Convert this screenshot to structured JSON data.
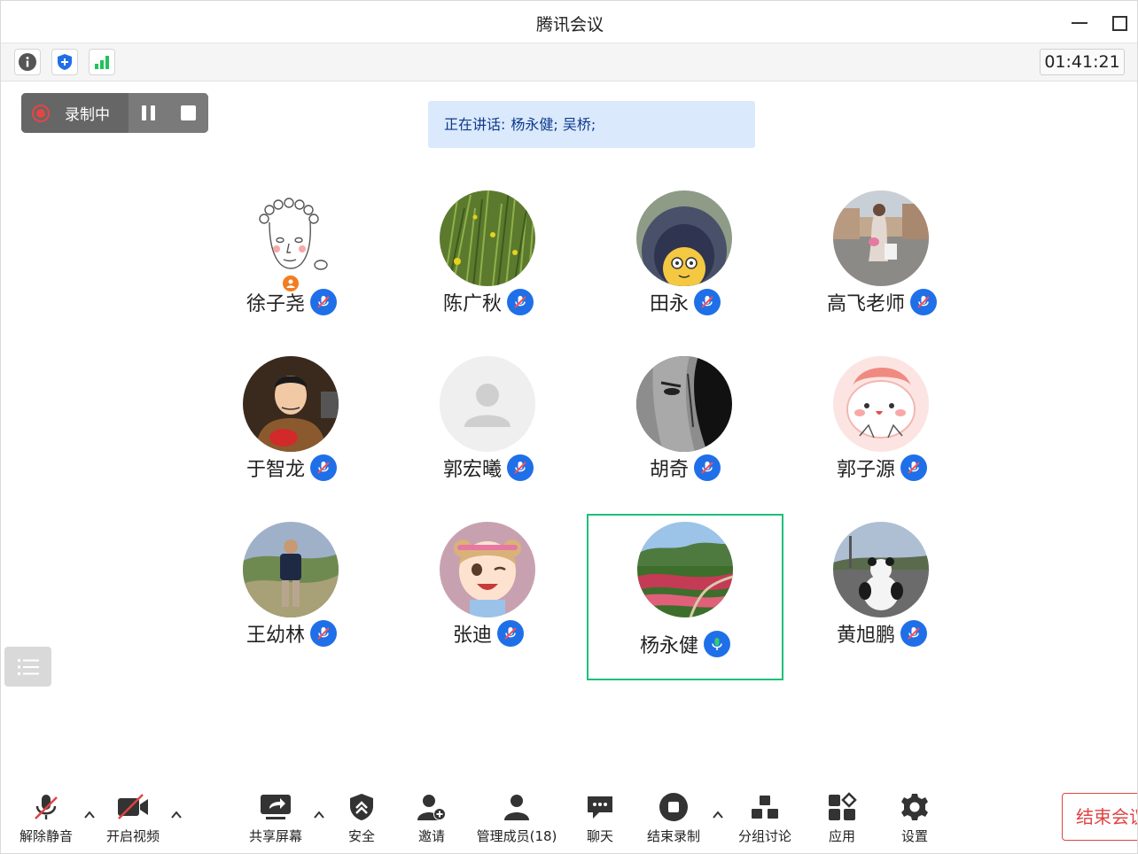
{
  "window": {
    "title": "腾讯会议"
  },
  "infobar": {
    "timer": "01:41:21"
  },
  "recording": {
    "status": "录制中"
  },
  "speaking": {
    "prefix": "正在讲话:",
    "names": "杨永健; 吴桥;"
  },
  "participants": [
    {
      "name": "徐子尧",
      "mic": "muted",
      "host": true
    },
    {
      "name": "陈广秋",
      "mic": "muted"
    },
    {
      "name": "田永",
      "mic": "muted"
    },
    {
      "name": "高飞老师",
      "mic": "muted"
    },
    {
      "name": "于智龙",
      "mic": "muted"
    },
    {
      "name": "郭宏曦",
      "mic": "muted"
    },
    {
      "name": "胡奇",
      "mic": "muted"
    },
    {
      "name": "郭子源",
      "mic": "muted"
    },
    {
      "name": "王幼林",
      "mic": "muted"
    },
    {
      "name": "张迪",
      "mic": "muted"
    },
    {
      "name": "杨永健",
      "mic": "speaking",
      "active": true
    },
    {
      "name": "黄旭鹏",
      "mic": "muted"
    }
  ],
  "toolbar": {
    "unmute": "解除静音",
    "video": "开启视频",
    "share": "共享屏幕",
    "security": "安全",
    "invite": "邀请",
    "members": "管理成员(18)",
    "chat": "聊天",
    "end_record": "结束录制",
    "breakout": "分组讨论",
    "apps": "应用",
    "settings": "设置",
    "end_meeting": "结束会议"
  },
  "colors": {
    "accent": "#1f6fe8",
    "active_border": "#1fbf7a",
    "speaking_mic": "#2fd16a",
    "danger": "#e04343",
    "record_dot": "#e54545"
  }
}
